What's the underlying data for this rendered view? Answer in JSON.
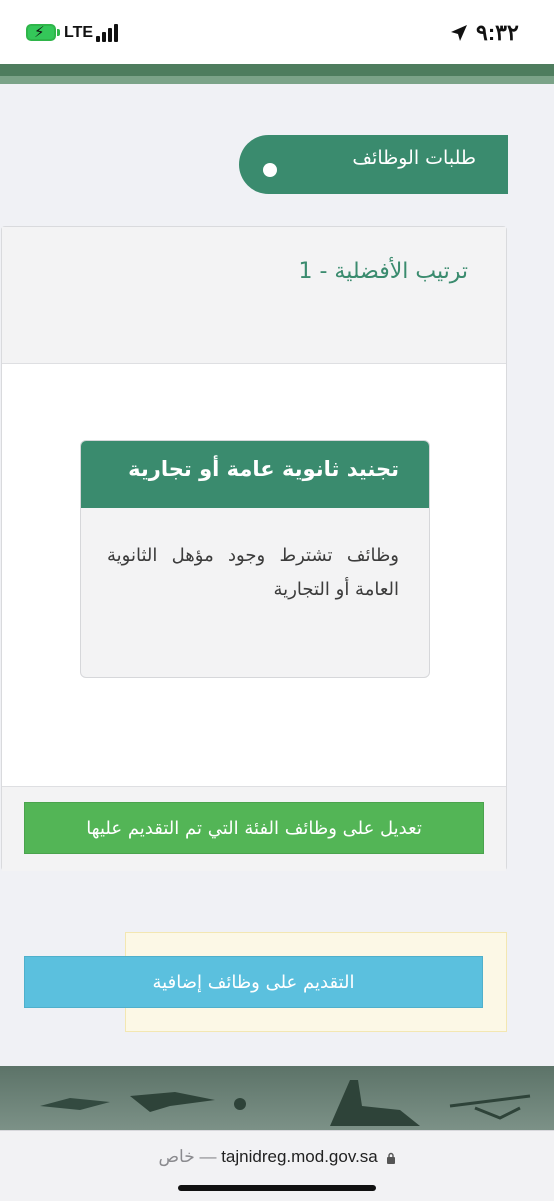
{
  "status_bar": {
    "time": "٩:٣٢",
    "network": "LTE",
    "battery_icon": "battery-charging-icon",
    "signal_icon": "signal-bars-icon",
    "location_icon": "location-arrow-icon"
  },
  "page": {
    "title": "طلبات الوظائف"
  },
  "card": {
    "header": "ترتيب الأفضلية - 1",
    "category": {
      "title": "تجنيد ثانوية عامة أو تجارية",
      "description": "وظائف تشترط وجود مؤهل الثانوية العامة أو التجارية"
    },
    "edit_button": "تعديل على وظائف الفئة التي تم التقديم عليها"
  },
  "extra": {
    "apply_button": "التقديم على وظائف إضافية"
  },
  "browser": {
    "url": "tajnidreg.mod.gov.sa",
    "separator": "—",
    "private_label": "خاص"
  },
  "colors": {
    "brand_green": "#3a8b6e",
    "button_green": "#53b556",
    "button_blue": "#5bc0de",
    "page_bg": "#f0f1f5"
  }
}
